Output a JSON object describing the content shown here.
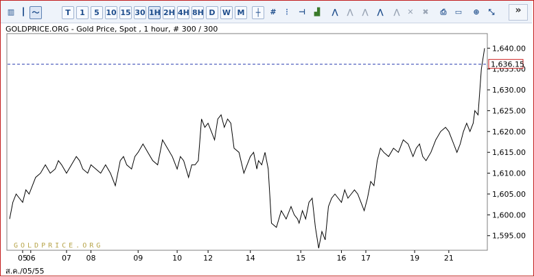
{
  "chart_title": "GOLDPRICE.ORG - Gold Price, Spot , 1 hour, # 300 / 300",
  "toolbar": {
    "periods": [
      "T",
      "1",
      "5",
      "10",
      "15",
      "30",
      "1H",
      "2H",
      "4H",
      "8H",
      "D",
      "W",
      "M"
    ],
    "selected_period": "1H",
    "expand_label": "»"
  },
  "watermark": "GOLDPRICE.ORG",
  "current_price_label": "1,636.15",
  "footer_date": "ส.ค./05/55",
  "chart_data": {
    "type": "line",
    "title": "GOLDPRICE.ORG - Gold Price, Spot , 1 hour, # 300 / 300",
    "xlabel": "",
    "ylabel": "",
    "ylim": [
      1591.5,
      1643.5
    ],
    "y_ticks": [
      "1,595.00",
      "1,600.00",
      "1,605.00",
      "1,610.00",
      "1,615.00",
      "1,620.00",
      "1,625.00",
      "1,630.00",
      "1,635.00",
      "1,640.00"
    ],
    "y_tick_values": [
      1595,
      1600,
      1605,
      1610,
      1615,
      1620,
      1625,
      1630,
      1635,
      1640
    ],
    "x_ticks": [
      {
        "label": "05",
        "index": 16
      },
      {
        "label": "06",
        "index": 26
      },
      {
        "label": "07",
        "index": 70
      },
      {
        "label": "08",
        "index": 100
      },
      {
        "label": "09",
        "index": 158
      },
      {
        "label": "10",
        "index": 206
      },
      {
        "label": "12",
        "index": 244
      },
      {
        "label": "14",
        "index": 296
      },
      {
        "label": "15",
        "index": 358
      },
      {
        "label": "16",
        "index": 408
      },
      {
        "label": "17",
        "index": 438
      },
      {
        "label": "19",
        "index": 498
      },
      {
        "label": "21",
        "index": 540
      }
    ],
    "n_points": 584,
    "current_price": 1636.15,
    "series": [
      {
        "values_index": [
          0,
          4,
          8,
          12,
          16,
          20,
          24,
          28,
          32,
          38,
          44,
          50,
          56,
          60,
          64,
          70,
          76,
          82,
          86,
          90,
          96,
          100,
          106,
          112,
          118,
          124,
          130,
          136,
          140,
          144,
          150,
          154,
          158,
          164,
          170,
          176,
          182,
          188,
          194,
          200,
          206,
          210,
          214,
          220,
          224,
          228,
          232,
          236,
          240,
          244,
          248,
          252,
          256,
          260,
          264,
          268,
          272,
          276,
          282,
          288,
          292,
          296,
          300,
          304,
          306,
          310,
          314,
          318,
          322,
          328,
          334,
          340,
          346,
          350,
          354,
          356,
          360,
          364,
          368,
          372,
          376,
          380,
          384,
          388,
          392,
          396,
          400,
          404,
          408,
          412,
          416,
          420,
          424,
          428,
          432,
          436,
          440,
          444,
          448,
          452,
          456,
          460,
          466,
          472,
          478,
          484,
          490,
          496,
          500,
          504,
          508,
          512,
          518,
          524,
          530,
          536,
          540,
          546,
          550,
          554,
          558,
          562,
          566,
          570,
          572,
          576,
          580,
          584
        ],
        "values": [
          1599,
          1603,
          1605,
          1604,
          1603,
          1606,
          1605,
          1607,
          1609,
          1610,
          1612,
          1610,
          1611,
          1613,
          1612,
          1610,
          1612,
          1614,
          1613,
          1611,
          1610,
          1612,
          1611,
          1610,
          1612,
          1610,
          1607,
          1613,
          1614,
          1612,
          1611,
          1614,
          1615,
          1617,
          1615,
          1613,
          1612,
          1618,
          1616,
          1614,
          1611,
          1614,
          1613,
          1609,
          1612,
          1612,
          1613,
          1623,
          1621,
          1622,
          1620,
          1618,
          1623,
          1624,
          1621,
          1623,
          1622,
          1616,
          1615,
          1610,
          1612,
          1614,
          1615,
          1611,
          1613,
          1612,
          1615,
          1611,
          1598,
          1597,
          1601,
          1599,
          1602,
          1600,
          1599,
          1598,
          1601,
          1599,
          1603,
          1604,
          1597,
          1592,
          1596,
          1594,
          1602,
          1604,
          1605,
          1604,
          1603,
          1606,
          1604,
          1605,
          1606,
          1605,
          1603,
          1601,
          1604,
          1608,
          1607,
          1613,
          1616,
          1615,
          1614,
          1616,
          1615,
          1618,
          1617,
          1614,
          1616,
          1617,
          1614,
          1613,
          1615,
          1618,
          1620,
          1621,
          1620,
          1617,
          1615,
          1617,
          1620,
          1622,
          1620,
          1622,
          1625,
          1624,
          1635,
          1640,
          1637
        ]
      }
    ]
  }
}
